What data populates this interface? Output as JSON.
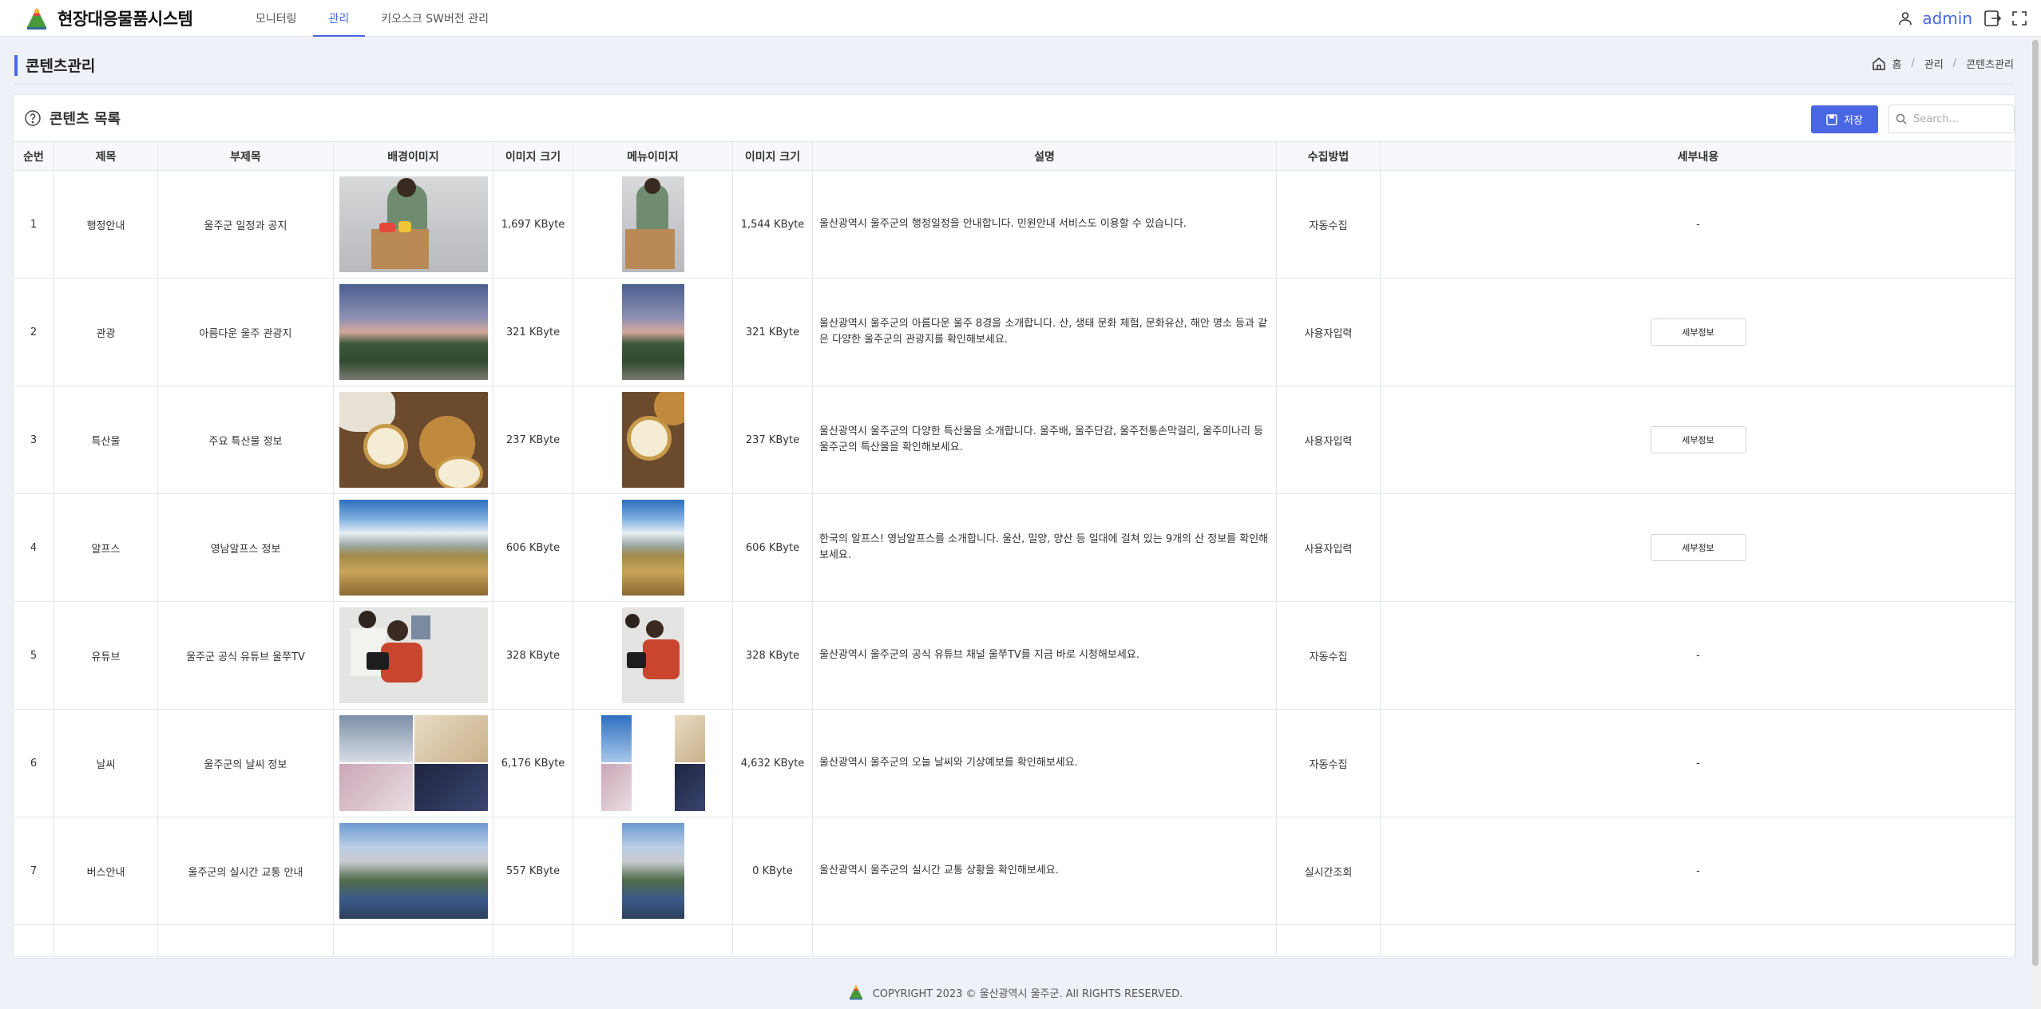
{
  "header": {
    "brand": "현장대응물품시스템",
    "nav": [
      {
        "label": "모니터링",
        "active": false
      },
      {
        "label": "관리",
        "active": true
      },
      {
        "label": "키오스크 SW버전 관리",
        "active": false
      }
    ],
    "user": "admin",
    "icons": [
      "user-icon",
      "logout-icon",
      "fullscreen-icon"
    ]
  },
  "page": {
    "title": "콘텐츠관리",
    "breadcrumb": [
      "홈",
      "관리",
      "콘텐츠관리"
    ]
  },
  "card": {
    "title": "콘텐츠 목록",
    "save_label": "저장",
    "search_placeholder": "Search..."
  },
  "table": {
    "columns": [
      "순번",
      "제목",
      "부제목",
      "배경이미지",
      "이미지 크기",
      "메뉴이미지",
      "이미지 크기",
      "설명",
      "수집방법",
      "세부내용"
    ],
    "rows": [
      {
        "no": "1",
        "title": "행정안내",
        "subtitle": "울주군 일정과 공지",
        "bg_size": "1,697 KByte",
        "menu_size": "1,544 KByte",
        "desc": "울산광역시 울주군의 행정일정을 안내합니다. 민원안내 서비스도 이용할 수 있습니다.",
        "method": "자동수집",
        "detail": "-",
        "image": "person-with-box"
      },
      {
        "no": "2",
        "title": "관광",
        "subtitle": "아름다운 울주 관광지",
        "bg_size": "321 KByte",
        "menu_size": "321 KByte",
        "desc": "울산광역시 울주군의 아름다운 울주 8경을 소개합니다. 산, 생태 문화 체험, 문화유산, 해안 명소 등과 같은 다양한 울주군의 관광지를 확인해보세요.",
        "method": "사용자입력",
        "detail": "세부정보",
        "image": "mountain-sunset"
      },
      {
        "no": "3",
        "title": "특산물",
        "subtitle": "주요 특산물 정보",
        "bg_size": "237 KByte",
        "menu_size": "237 KByte",
        "desc": "울산광역시 울주군의 다양한 특산물을 소개합니다. 울주배, 울주단감, 울주전통손막걸리, 울주미나리 등 울주군의 특산물을 확인해보세요.",
        "method": "사용자입력",
        "detail": "세부정보",
        "image": "pears"
      },
      {
        "no": "4",
        "title": "알프스",
        "subtitle": "영남알프스 정보",
        "bg_size": "606 KByte",
        "menu_size": "606 KByte",
        "desc": "한국의 알프스! 영남알프스를 소개합니다. 울산, 밀양, 양산 등 일대에 걸쳐 있는 9개의 산 정보를 확인해보세요.",
        "method": "사용자입력",
        "detail": "세부정보",
        "image": "grassland"
      },
      {
        "no": "5",
        "title": "유튜브",
        "subtitle": "울주군 공식 유튜브 울쭈TV",
        "bg_size": "328 KByte",
        "menu_size": "328 KByte",
        "desc": "울산광역시 울주군의 공식 유튜브 채널 울쭈TV를 지금 바로 시청해보세요.",
        "method": "자동수집",
        "detail": "-",
        "image": "camera-man"
      },
      {
        "no": "6",
        "title": "날씨",
        "subtitle": "울주군의 날씨 정보",
        "bg_size": "6,176 KByte",
        "menu_size": "4,632 KByte",
        "desc": "울산광역시 울주군의 오늘 날씨와 기상예보를 확인해보세요.",
        "method": "자동수집",
        "detail": "-",
        "image": "four-seasons"
      },
      {
        "no": "7",
        "title": "버스안내",
        "subtitle": "울주군의 실시간 교통 안내",
        "bg_size": "557 KByte",
        "menu_size": "0 KByte",
        "desc": "울산광역시 울주군의 실시간 교통 상황을 확인해보세요.",
        "method": "실시간조회",
        "detail": "-",
        "image": "city-road"
      }
    ]
  },
  "footer": {
    "copyright": "COPYRIGHT 2023 © 울산광역시 울주군. All RIGHTS RESERVED."
  },
  "colors": {
    "accent": "#4a67e3",
    "background": "#eef1f8"
  }
}
